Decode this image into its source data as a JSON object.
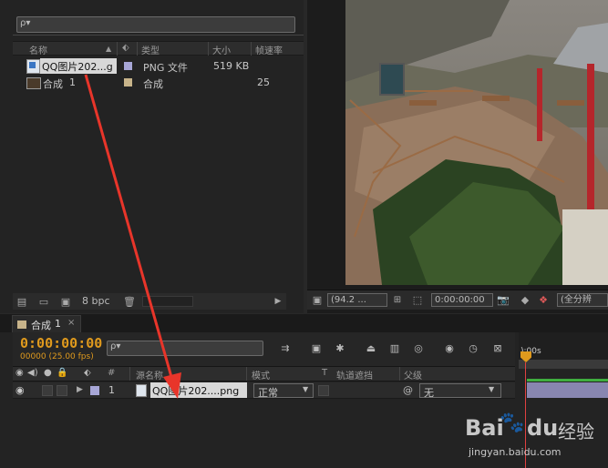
{
  "project": {
    "search_placeholder": "ρ▾",
    "columns": {
      "name": "名称",
      "type": "类型",
      "size": "大小",
      "fps": "帧速率"
    },
    "items": [
      {
        "name": "QQ图片202...g",
        "type": "PNG 文件",
        "size": "519 KB",
        "fps": "",
        "label_color": "#a7a6d6"
      },
      {
        "name": "合成",
        "count": "1",
        "type": "合成",
        "size": "",
        "fps": "25",
        "label_color": "#c8b48a"
      }
    ],
    "footer": {
      "bpc": "8 bpc"
    }
  },
  "viewer": {
    "zoom": "(94.2 ...",
    "timecode": "0:00:00:00",
    "resolution": "(全分辨"
  },
  "timeline": {
    "tab_label": "合成",
    "tab_number": "1",
    "timecode": "0:00:00:00",
    "fps_info": "00000 (25.00 fps)",
    "search_placeholder": "ρ▾",
    "ruler_label": "):00s",
    "columns": {
      "num": "#",
      "source": "源名称",
      "mode": "模式",
      "t": "T",
      "trkmat": "轨道遮挡",
      "parent": "父级"
    },
    "layer": {
      "num": "1",
      "name": "QQ图片202....png",
      "mode": "正常",
      "parent": "无",
      "label_color": "#a7a6d6"
    }
  },
  "watermark": {
    "brand": "Bai",
    "brand2": "du",
    "text": "经验",
    "url": "jingyan.baidu.com"
  },
  "colors": {
    "accent": "#e09a1d",
    "arrow": "#e8352a"
  }
}
